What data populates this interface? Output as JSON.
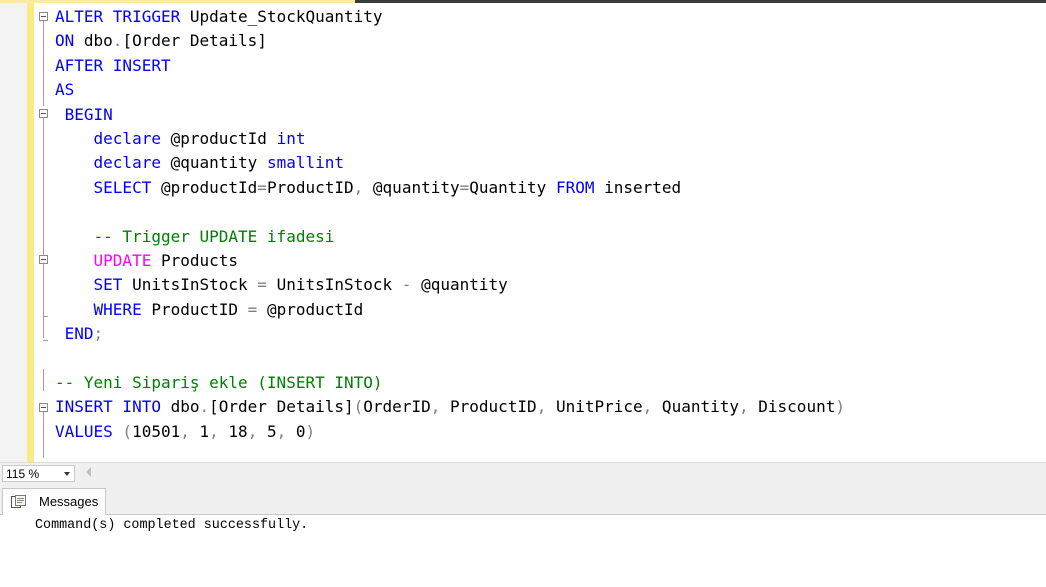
{
  "editor": {
    "lines": [
      [
        {
          "t": "ALTER TRIGGER",
          "c": "kw"
        },
        {
          "t": " Update_StockQuantity",
          "c": ""
        }
      ],
      [
        {
          "t": "ON",
          "c": "kw"
        },
        {
          "t": " dbo",
          "c": ""
        },
        {
          "t": ".",
          "c": "gy"
        },
        {
          "t": "[Order Details]",
          "c": ""
        }
      ],
      [
        {
          "t": "AFTER INSERT",
          "c": "kw"
        }
      ],
      [
        {
          "t": "AS",
          "c": "kw"
        }
      ],
      [
        {
          "t": " BEGIN",
          "c": "kw"
        }
      ],
      [
        {
          "t": "    declare",
          "c": "kw"
        },
        {
          "t": " @productId ",
          "c": ""
        },
        {
          "t": "int",
          "c": "kw"
        }
      ],
      [
        {
          "t": "    declare",
          "c": "kw"
        },
        {
          "t": " @quantity ",
          "c": ""
        },
        {
          "t": "smallint",
          "c": "kw"
        }
      ],
      [
        {
          "t": "    SELECT",
          "c": "kw"
        },
        {
          "t": " @productId",
          "c": ""
        },
        {
          "t": "=",
          "c": "gy"
        },
        {
          "t": "ProductID",
          "c": ""
        },
        {
          "t": ",",
          "c": "gy"
        },
        {
          "t": " @quantity",
          "c": ""
        },
        {
          "t": "=",
          "c": "gy"
        },
        {
          "t": "Quantity ",
          "c": ""
        },
        {
          "t": "FROM",
          "c": "kw"
        },
        {
          "t": " inserted",
          "c": ""
        }
      ],
      [],
      [
        {
          "t": "    -- Trigger UPDATE ifadesi",
          "c": "cm"
        }
      ],
      [
        {
          "t": "    UPDATE",
          "c": "pk"
        },
        {
          "t": " Products",
          "c": ""
        }
      ],
      [
        {
          "t": "    SET",
          "c": "kw"
        },
        {
          "t": " UnitsInStock ",
          "c": ""
        },
        {
          "t": "=",
          "c": "gy"
        },
        {
          "t": " UnitsInStock ",
          "c": ""
        },
        {
          "t": "-",
          "c": "gy"
        },
        {
          "t": " @quantity",
          "c": ""
        }
      ],
      [
        {
          "t": "    WHERE",
          "c": "kw"
        },
        {
          "t": " ProductID ",
          "c": ""
        },
        {
          "t": "=",
          "c": "gy"
        },
        {
          "t": " @productId",
          "c": ""
        }
      ],
      [
        {
          "t": " END",
          "c": "kw"
        },
        {
          "t": ";",
          "c": "gy"
        }
      ],
      [],
      [
        {
          "t": "-- Yeni Sipariş ekle (INSERT INTO)",
          "c": "cm"
        }
      ],
      [
        {
          "t": "INSERT INTO",
          "c": "kw"
        },
        {
          "t": " dbo",
          "c": ""
        },
        {
          "t": ".",
          "c": "gy"
        },
        {
          "t": "[Order Details]",
          "c": ""
        },
        {
          "t": "(",
          "c": "gy"
        },
        {
          "t": "OrderID",
          "c": ""
        },
        {
          "t": ",",
          "c": "gy"
        },
        {
          "t": " ProductID",
          "c": ""
        },
        {
          "t": ",",
          "c": "gy"
        },
        {
          "t": " UnitPrice",
          "c": ""
        },
        {
          "t": ",",
          "c": "gy"
        },
        {
          "t": " Quantity",
          "c": ""
        },
        {
          "t": ",",
          "c": "gy"
        },
        {
          "t": " Discount",
          "c": ""
        },
        {
          "t": ")",
          "c": "gy"
        }
      ],
      [
        {
          "t": "VALUES",
          "c": "kw"
        },
        {
          "t": " (",
          "c": "gy"
        },
        {
          "t": "10501",
          "c": ""
        },
        {
          "t": ",",
          "c": "gy"
        },
        {
          "t": " 1",
          "c": ""
        },
        {
          "t": ",",
          "c": "gy"
        },
        {
          "t": " 18",
          "c": ""
        },
        {
          "t": ",",
          "c": "gy"
        },
        {
          "t": " 5",
          "c": ""
        },
        {
          "t": ",",
          "c": "gy"
        },
        {
          "t": " 0",
          "c": ""
        },
        {
          "t": ")",
          "c": "gy"
        }
      ]
    ]
  },
  "zoom": {
    "value": "115 %"
  },
  "results": {
    "tab_label": "Messages",
    "message": "Command(s) completed successfully."
  },
  "colors": {
    "keyword": "#0000ff",
    "function": "#ff00ff",
    "comment": "#008000",
    "operator": "#808080",
    "change_bar": "#fbe984"
  },
  "icons": {
    "fold": "collapse-box-icon",
    "zoom_dropdown": "chevron-down-icon",
    "scroll_left": "scroll-left-arrow-icon",
    "messages": "messages-icon"
  }
}
